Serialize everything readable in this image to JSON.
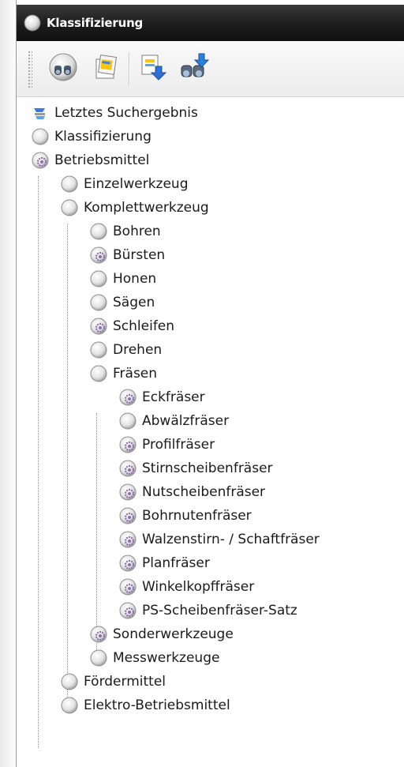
{
  "window": {
    "title": "Klassifizierung"
  },
  "toolbar": {
    "buttons": [
      {
        "icon": "binoculars-search-icon"
      },
      {
        "icon": "notes-icon"
      },
      {
        "icon": "export-down-icon"
      },
      {
        "icon": "binoculars-arrow-icon"
      }
    ]
  },
  "tree": {
    "nodes": [
      {
        "label": "Letztes Suchergebnis",
        "icon": "search-result-icon",
        "depth": 0,
        "expander": "none"
      },
      {
        "label": "Klassifizierung",
        "icon": "folder-sphere-icon",
        "depth": 0,
        "expander": "none"
      },
      {
        "label": "Betriebsmittel",
        "icon": "gear-sphere-icon",
        "depth": 0,
        "expander": "minus"
      },
      {
        "label": "Einzelwerkzeug",
        "icon": "folder-sphere-icon",
        "depth": 1,
        "expander": "plus"
      },
      {
        "label": "Komplettwerkzeug",
        "icon": "folder-sphere-icon",
        "depth": 1,
        "expander": "minus"
      },
      {
        "label": "Bohren",
        "icon": "folder-sphere-icon",
        "depth": 2,
        "expander": "plus"
      },
      {
        "label": "Bürsten",
        "icon": "gear-sphere-icon",
        "depth": 2,
        "expander": "plus"
      },
      {
        "label": "Honen",
        "icon": "folder-sphere-icon",
        "depth": 2,
        "expander": "plus"
      },
      {
        "label": "Sägen",
        "icon": "folder-sphere-icon",
        "depth": 2,
        "expander": "plus"
      },
      {
        "label": "Schleifen",
        "icon": "gear-sphere-icon",
        "depth": 2,
        "expander": "plus"
      },
      {
        "label": "Drehen",
        "icon": "folder-sphere-icon",
        "depth": 2,
        "expander": "plus"
      },
      {
        "label": "Fräsen",
        "icon": "folder-sphere-icon",
        "depth": 2,
        "expander": "minus"
      },
      {
        "label": "Eckfräser",
        "icon": "gear-sphere-icon",
        "depth": 3,
        "expander": "plus"
      },
      {
        "label": "Abwälzfräser",
        "icon": "folder-sphere-icon",
        "depth": 3,
        "expander": "plus"
      },
      {
        "label": "Profilfräser",
        "icon": "gear-sphere-icon",
        "depth": 3,
        "expander": "plus"
      },
      {
        "label": "Stirnscheibenfräser",
        "icon": "gear-sphere-icon",
        "depth": 3,
        "expander": "plus"
      },
      {
        "label": "Nutscheibenfräser",
        "icon": "gear-sphere-icon",
        "depth": 3,
        "expander": "plus"
      },
      {
        "label": "Bohrnutenfräser",
        "icon": "gear-sphere-icon",
        "depth": 3,
        "expander": "plus"
      },
      {
        "label": "Walzenstirn- / Schaftfräser",
        "icon": "gear-sphere-icon",
        "depth": 3,
        "expander": "plus"
      },
      {
        "label": "Planfräser",
        "icon": "gear-sphere-icon",
        "depth": 3,
        "expander": "plus"
      },
      {
        "label": "Winkelkopffräser",
        "icon": "gear-sphere-icon",
        "depth": 3,
        "expander": "plus"
      },
      {
        "label": "PS-Scheibenfräser-Satz",
        "icon": "gear-sphere-icon",
        "depth": 3,
        "expander": "plus"
      },
      {
        "label": "Sonderwerkzeuge",
        "icon": "gear-sphere-icon",
        "depth": 2,
        "expander": "plus"
      },
      {
        "label": "Messwerkzeuge",
        "icon": "folder-sphere-icon",
        "depth": 2,
        "expander": "plus"
      },
      {
        "label": "Fördermittel",
        "icon": "folder-sphere-icon",
        "depth": 1,
        "expander": "plus"
      },
      {
        "label": "Elektro-Betriebsmittel",
        "icon": "folder-sphere-icon",
        "depth": 1,
        "expander": "plus"
      }
    ]
  },
  "colors": {
    "titlebar": "#1c1c1c",
    "gear": "#8a6fa8",
    "tree_line": "#8f8f8f"
  }
}
